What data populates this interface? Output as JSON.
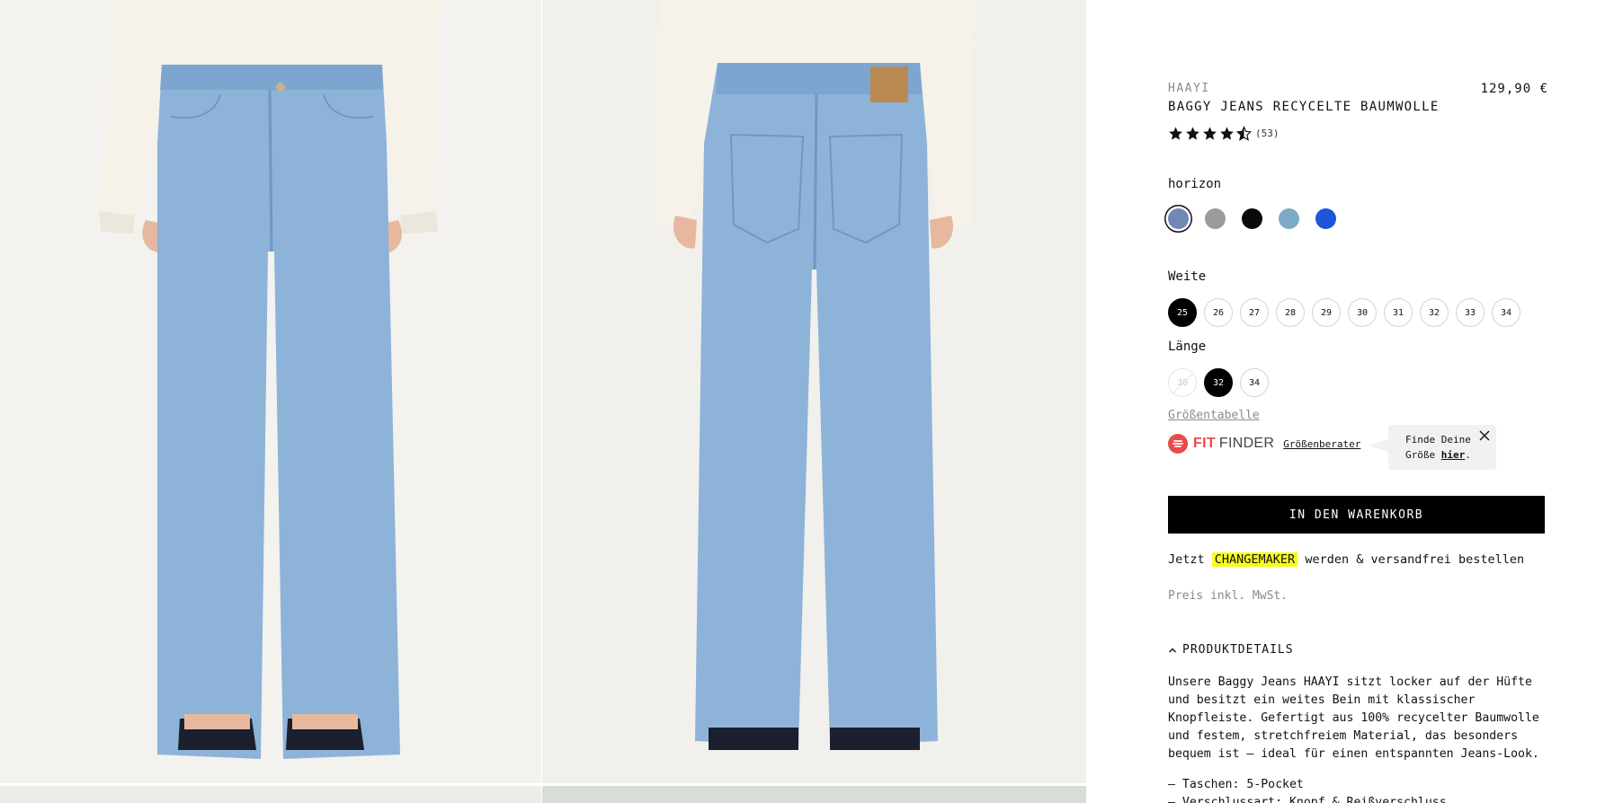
{
  "product": {
    "brand": "HAAYI",
    "name": "BAGGY JEANS RECYCELTE BAUMWOLLE",
    "price": "129,90 €",
    "rating": {
      "stars": 4.5,
      "max": 5,
      "count_label": "(53)"
    }
  },
  "color": {
    "selected_name": "horizon",
    "swatches": [
      {
        "name": "horizon",
        "hex": "#7287b6",
        "selected": true
      },
      {
        "name": "grey",
        "hex": "#9b9b9b",
        "selected": false
      },
      {
        "name": "black",
        "hex": "#0a0a0a",
        "selected": false
      },
      {
        "name": "light-blue",
        "hex": "#7ca9c4",
        "selected": false
      },
      {
        "name": "royal-blue",
        "hex": "#1c56d9",
        "selected": false
      }
    ]
  },
  "width": {
    "label": "Weite",
    "options": [
      {
        "value": "25",
        "selected": true
      },
      {
        "value": "26"
      },
      {
        "value": "27"
      },
      {
        "value": "28"
      },
      {
        "value": "29"
      },
      {
        "value": "30"
      },
      {
        "value": "31"
      },
      {
        "value": "32"
      },
      {
        "value": "33"
      },
      {
        "value": "34"
      }
    ]
  },
  "length": {
    "label": "Länge",
    "options": [
      {
        "value": "30",
        "disabled": true
      },
      {
        "value": "32",
        "selected": true
      },
      {
        "value": "34"
      }
    ]
  },
  "size_chart_link": "Größentabelle",
  "fit_finder": {
    "logo_word1": "FIT",
    "logo_word2": "FINDER",
    "advisor_link": "Größenberater",
    "tooltip_line1": "Finde Deine",
    "tooltip_line2_prefix": "Größe ",
    "tooltip_link": "hier",
    "tooltip_suffix": "."
  },
  "cart_button": "IN DEN WARENKORB",
  "promo": {
    "before": "Jetzt ",
    "highlight": "CHANGEMAKER",
    "after": " werden & versandfrei bestellen"
  },
  "vat_note": "Preis inkl. MwSt.",
  "details": {
    "toggle_label": "PRODUKTDETAILS",
    "description": "Unsere Baggy Jeans HAAYI sitzt locker auf der Hüfte und besitzt ein weites Bein mit klassischer Knopfleiste. Gefertigt aus 100% recycelter Baumwolle und festem, stretchfreiem Material, das besonders bequem ist – ideal für einen entspannten Jeans-Look.",
    "list": [
      "Taschen: 5-Pocket",
      "Verschlussart: Knopf & Reißverschluss"
    ]
  },
  "colors": {
    "denim": "#8db3d9",
    "denim_dark": "#6f98c4",
    "shirt": "#f6f2ea",
    "background": "#f3f2ef",
    "accent_red": "#e94b4b",
    "highlight_yellow": "#f7ff1b"
  }
}
